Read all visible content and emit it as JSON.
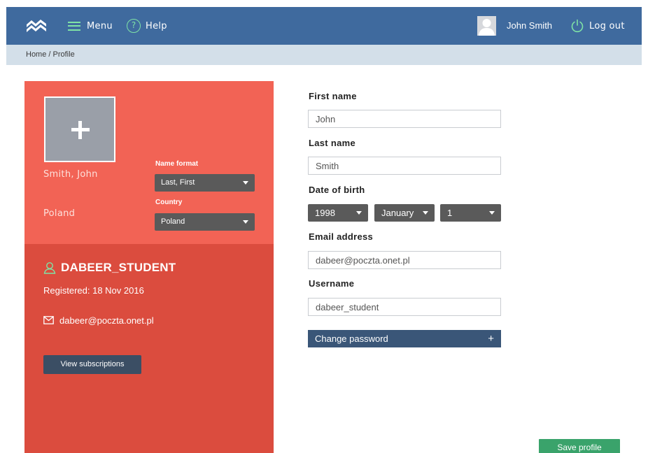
{
  "nav": {
    "menu_label": "Menu",
    "help_label": "Help",
    "user_name": "John Smith",
    "logout_label": "Log out"
  },
  "breadcrumb": "Home / Profile",
  "profile_card": {
    "display_name": "Smith, John",
    "country": "Poland",
    "name_format_label": "Name format",
    "name_format_value": "Last, First",
    "country_label": "Country",
    "country_value": "Poland",
    "username": "DABEER_STUDENT",
    "registered": "Registered: 18 Nov 2016",
    "email": "dabeer@poczta.onet.pl",
    "subscriptions_button": "View subscriptions"
  },
  "form": {
    "first_name_label": "First name",
    "first_name_value": "John",
    "last_name_label": "Last name",
    "last_name_value": "Smith",
    "dob_label": "Date of birth",
    "dob_year": "1998",
    "dob_month": "January",
    "dob_day": "1",
    "email_label": "Email address",
    "email_value": "dabeer@poczta.onet.pl",
    "username_label": "Username",
    "username_value": "dabeer_student",
    "change_password_label": "Change password",
    "change_password_icon": "+",
    "save_button": "Save profile"
  },
  "colors": {
    "nav_bg": "#3f6a9e",
    "breadcrumb_bg": "#d3dfe9",
    "card_top": "#f26355",
    "card_bottom": "#db4c3e",
    "accent_green": "#7fe3a6",
    "save_green": "#3aa36b"
  },
  "icons": [
    "logo-icon",
    "menu-icon",
    "help-icon",
    "avatar-icon",
    "power-icon",
    "add-photo-icon",
    "user-icon",
    "mail-icon",
    "caret-down-icon",
    "plus-icon"
  ]
}
